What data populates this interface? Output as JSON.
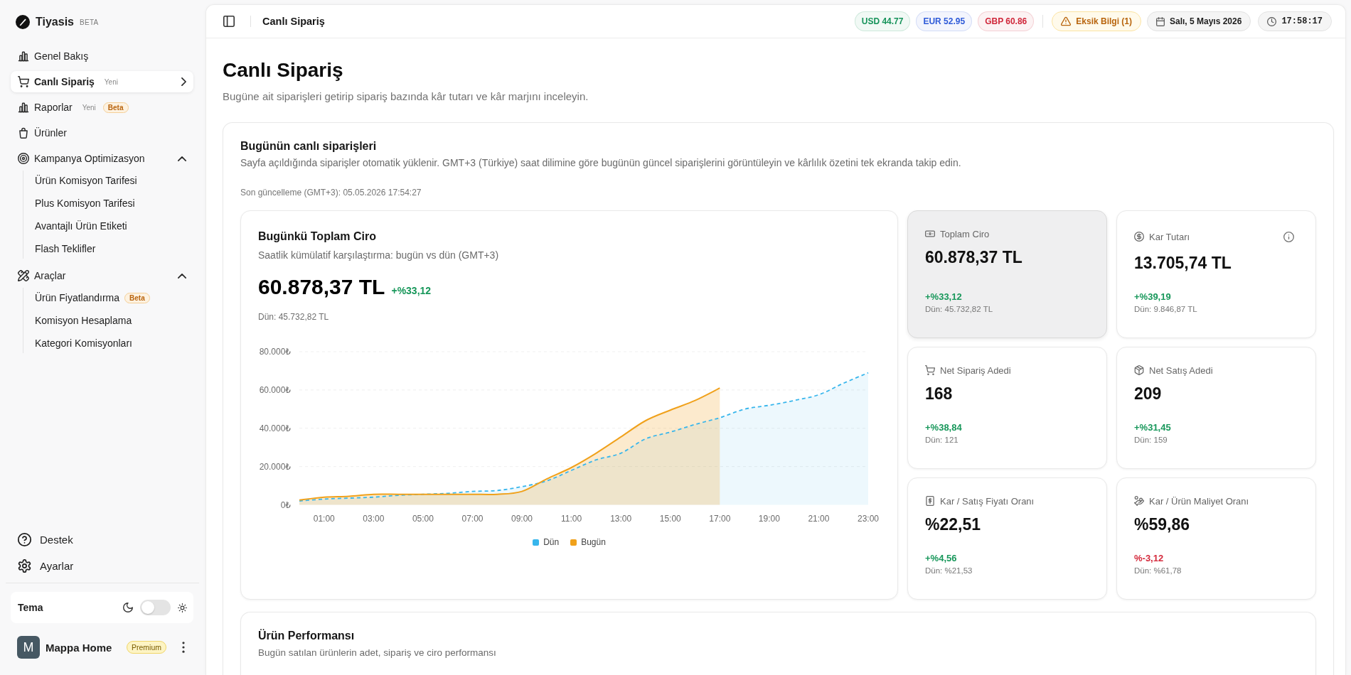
{
  "sidebar": {
    "brand": {
      "name": "Tiyasis",
      "tag": "BETA"
    },
    "nav": [
      {
        "label": "Genel Bakış",
        "selected": false
      },
      {
        "label": "Canlı Sipariş",
        "selected": true,
        "tags": [
          {
            "text": "Yeni",
            "kind": "plain"
          }
        ]
      },
      {
        "label": "Raporlar",
        "selected": false,
        "tags": [
          {
            "text": "Yeni",
            "kind": "plain"
          },
          {
            "text": "Beta",
            "kind": "pill"
          }
        ]
      },
      {
        "label": "Ürünler",
        "selected": false
      },
      {
        "label": "Kampanya Optimizasyon",
        "selected": false,
        "expanded": true,
        "children": [
          {
            "label": "Ürün Komisyon Tarifesi",
            "selected": false
          },
          {
            "label": "Plus Komisyon Tarifesi",
            "selected": false
          },
          {
            "label": "Avantajlı Ürün Etiketi",
            "selected": false
          },
          {
            "label": "Flash Teklifler",
            "selected": false
          }
        ]
      },
      {
        "label": "Araçlar",
        "selected": false,
        "expanded": true,
        "children": [
          {
            "label": "Ürün Fiyatlandırma",
            "selected": false,
            "tags": [
              {
                "text": "Beta",
                "kind": "pill"
              }
            ]
          },
          {
            "label": "Komisyon Hesaplama",
            "selected": false
          },
          {
            "label": "Kategori Komisyonları",
            "selected": false
          }
        ]
      }
    ],
    "footer": [
      {
        "label": "Destek"
      },
      {
        "label": "Ayarlar"
      }
    ],
    "theme": {
      "label": "Tema",
      "dark": false
    },
    "user": {
      "initial": "M",
      "name": "Mappa Home",
      "plan": "Premium"
    }
  },
  "topbar": {
    "title": "Canlı Sipariş",
    "rates": [
      {
        "text": "USD 44.77",
        "color": "#16935a"
      },
      {
        "text": "EUR 52.95",
        "color": "#2f5bd8"
      },
      {
        "text": "GBP 60.86",
        "color": "#d0283b"
      }
    ],
    "alert": "Eksik Bilgi (1)",
    "date": "Salı, 5 Mayıs 2026",
    "time": "17:58:17"
  },
  "page": {
    "title": "Canlı Sipariş",
    "subtitle": "Bugüne ait siparişleri getirip sipariş bazında kâr tutarı ve kâr marjını inceleyin."
  },
  "live": {
    "title": "Bugünün canlı siparişleri",
    "description": "Sayfa açıldığında siparişler otomatik yüklenir. GMT+3 (Türkiye) saat dilimine göre bugünün güncel siparişlerini görüntüleyin ve kârlılık özetini tek ekranda takip edin.",
    "updated": "Son güncelleme (GMT+3): 05.05.2026 17:54:27",
    "chart": {
      "title": "Bugünkü Toplam Ciro",
      "subtitle": "Saatlik kümülatif karşılaştırma: bugün vs dün (GMT+3)",
      "total": "60.878,37 TL",
      "change": "+%33,12",
      "positive": true,
      "previous": "Dün: 45.732,82 TL",
      "chart_data": {
        "type": "area",
        "x": [
          0,
          1,
          2,
          3,
          4,
          5,
          6,
          7,
          8,
          9,
          10,
          11,
          12,
          13,
          14,
          15,
          16,
          17,
          18,
          19,
          20,
          21,
          22,
          23
        ],
        "series": [
          {
            "name": "Dün",
            "color": "#38b6ec",
            "values": [
              2000,
              3000,
              3500,
              4000,
              5000,
              5500,
              6000,
              7000,
              7500,
              9500,
              12500,
              18000,
              23500,
              27000,
              34500,
              38000,
              42000,
              45500,
              50000,
              52000,
              54500,
              57500,
              63500,
              69000
            ]
          },
          {
            "name": "Bugün",
            "color": "#f0a11b",
            "values": [
              2500,
              4000,
              4500,
              5500,
              5500,
              5500,
              5500,
              5500,
              5500,
              7000,
              13500,
              19500,
              27000,
              35500,
              44000,
              49500,
              54500,
              61000,
              null,
              null,
              null,
              null,
              null,
              null
            ]
          }
        ],
        "xlim": [
          0,
          23
        ],
        "ylim": [
          0,
          80000
        ],
        "xticks": [
          {
            "value": 1,
            "label": "01:00"
          },
          {
            "value": 3,
            "label": "03:00"
          },
          {
            "value": 5,
            "label": "05:00"
          },
          {
            "value": 7,
            "label": "07:00"
          },
          {
            "value": 9,
            "label": "09:00"
          },
          {
            "value": 11,
            "label": "11:00"
          },
          {
            "value": 13,
            "label": "13:00"
          },
          {
            "value": 15,
            "label": "15:00"
          },
          {
            "value": 17,
            "label": "17:00"
          },
          {
            "value": 19,
            "label": "19:00"
          },
          {
            "value": 21,
            "label": "21:00"
          },
          {
            "value": 23,
            "label": "23:00"
          }
        ],
        "yticks": [
          {
            "value": 0,
            "label": "0₺"
          },
          {
            "value": 20000,
            "label": "20.000₺"
          },
          {
            "value": 40000,
            "label": "40.000₺"
          },
          {
            "value": 60000,
            "label": "60.000₺"
          },
          {
            "value": 80000,
            "label": "80.000₺"
          }
        ],
        "grid": true,
        "legend": "bottom"
      }
    },
    "stats": [
      {
        "label": "Toplam Ciro",
        "value": "60.878,37 TL",
        "change": "+%33,12",
        "positive": true,
        "previous": "Dün: 45.732,82 TL",
        "highlighted": true,
        "info": false
      },
      {
        "label": "Kar Tutarı",
        "value": "13.705,74 TL",
        "change": "+%39,19",
        "positive": true,
        "previous": "Dün: 9.846,87 TL",
        "highlighted": false,
        "info": true
      },
      {
        "label": "Net Sipariş Adedi",
        "value": "168",
        "change": "+%38,84",
        "positive": true,
        "previous": "Dün: 121",
        "highlighted": false,
        "info": false
      },
      {
        "label": "Net Satış Adedi",
        "value": "209",
        "change": "+%31,45",
        "positive": true,
        "previous": "Dün: 159",
        "highlighted": false,
        "info": false
      },
      {
        "label": "Kar / Satış Fiyatı Oranı",
        "value": "%22,51",
        "change": "+%4,56",
        "positive": true,
        "previous": "Dün: %21,53",
        "highlighted": false,
        "info": false
      },
      {
        "label": "Kar / Ürün Maliyet Oranı",
        "value": "%59,86",
        "change": "%-3,12",
        "positive": false,
        "previous": "Dün: %61,78",
        "highlighted": false,
        "info": false
      }
    ]
  },
  "performance": {
    "title": "Ürün Performansı",
    "subtitle": "Bugün satılan ürünlerin adet, sipariş ve ciro performansı"
  }
}
